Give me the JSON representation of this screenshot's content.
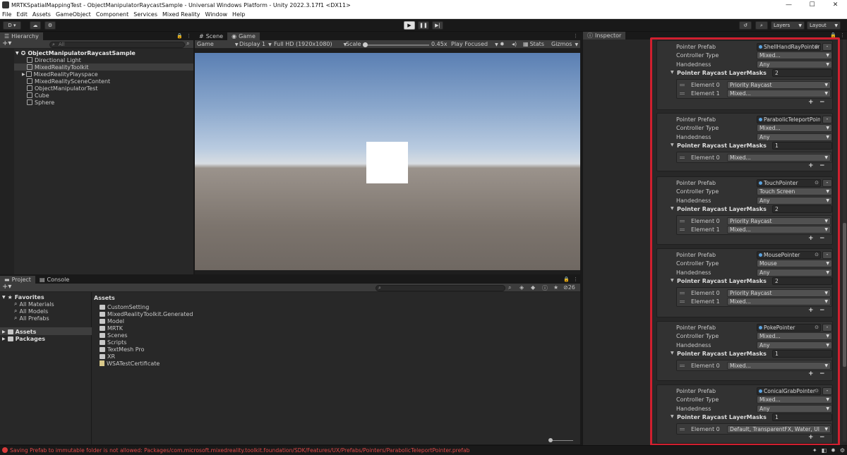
{
  "window": {
    "title": "MRTKSpatialMappingTest - ObjectManipulatorRaycastSample - Universal Windows Platform - Unity 2022.3.17f1 <DX11>",
    "minimize": "—",
    "maximize": "☐",
    "close": "✕"
  },
  "menu": [
    "File",
    "Edit",
    "Assets",
    "GameObject",
    "Component",
    "Services",
    "Mixed Reality",
    "Window",
    "Help"
  ],
  "toolbar": {
    "account": "D ▾",
    "layers": "Layers",
    "layout": "Layout"
  },
  "hierarchy": {
    "tab": "Hierarchy",
    "search_placeholder": "All",
    "root": "ObjectManipulatorRaycastSample",
    "items": [
      "Directional Light",
      "MixedRealityToolkit",
      "MixedRealityPlayspace",
      "MixedRealitySceneContent",
      "ObjectManipulatorTest",
      "Cube",
      "Sphere"
    ]
  },
  "scene_tabs": [
    "Scene",
    "Game"
  ],
  "game_toolbar": {
    "display_mode": "Game",
    "display": "Display 1",
    "resolution": "Full HD (1920x1080)",
    "scale_label": "Scale",
    "scale_value": "0.45x",
    "play_mode": "Play Focused",
    "stats": "Stats",
    "gizmos": "Gizmos"
  },
  "project": {
    "tabs": [
      "Project",
      "Console"
    ],
    "favorites_label": "Favorites",
    "favorites": [
      "All Materials",
      "All Models",
      "All Prefabs"
    ],
    "roots": [
      "Assets",
      "Packages"
    ],
    "assets_header": "Assets",
    "assets": [
      "CustomSetting",
      "MixedRealityToolkit.Generated",
      "Model",
      "MRTK",
      "Scenes",
      "Scripts",
      "TextMesh Pro",
      "XR",
      "WSATestCertificate"
    ],
    "hidden_count": "26"
  },
  "inspector": {
    "tab": "Inspector",
    "labels": {
      "prefab": "Pointer Prefab",
      "controller": "Controller Type",
      "handedness": "Handedness",
      "masks": "Pointer Raycast LayerMasks"
    },
    "pointers": [
      {
        "prefab": "ShellHandRayPointer",
        "controller": "Mixed...",
        "handedness": "Any",
        "count": "2",
        "elements": [
          {
            "label": "Element 0",
            "value": "Priority Raycast"
          },
          {
            "label": "Element 1",
            "value": "Mixed..."
          }
        ]
      },
      {
        "prefab": "ParabolicTeleportPointer",
        "controller": "Mixed...",
        "handedness": "Any",
        "count": "1",
        "elements": [
          {
            "label": "Element 0",
            "value": "Mixed..."
          }
        ]
      },
      {
        "prefab": "TouchPointer",
        "controller": "Touch Screen",
        "handedness": "Any",
        "count": "2",
        "elements": [
          {
            "label": "Element 0",
            "value": "Priority Raycast"
          },
          {
            "label": "Element 1",
            "value": "Mixed..."
          }
        ]
      },
      {
        "prefab": "MousePointer",
        "controller": "Mouse",
        "handedness": "Any",
        "count": "2",
        "elements": [
          {
            "label": "Element 0",
            "value": "Priority Raycast"
          },
          {
            "label": "Element 1",
            "value": "Mixed..."
          }
        ]
      },
      {
        "prefab": "PokePointer",
        "controller": "Mixed...",
        "handedness": "Any",
        "count": "1",
        "elements": [
          {
            "label": "Element 0",
            "value": "Mixed..."
          }
        ]
      },
      {
        "prefab": "ConicalGrabPointer",
        "controller": "Mixed...",
        "handedness": "Any",
        "count": "1",
        "elements": [
          {
            "label": "Element 0",
            "value": "Default, TransparentFX, Water, UI"
          }
        ]
      }
    ]
  },
  "status": {
    "message": "Saving Prefab to immutable folder is not allowed: Packages/com.microsoft.mixedreality.toolkit.foundation/SDK/Features/UX/Prefabs/Pointers/ParabolicTeleportPointer.prefab"
  },
  "accent": {
    "highlight_box": "#d11f2f"
  }
}
